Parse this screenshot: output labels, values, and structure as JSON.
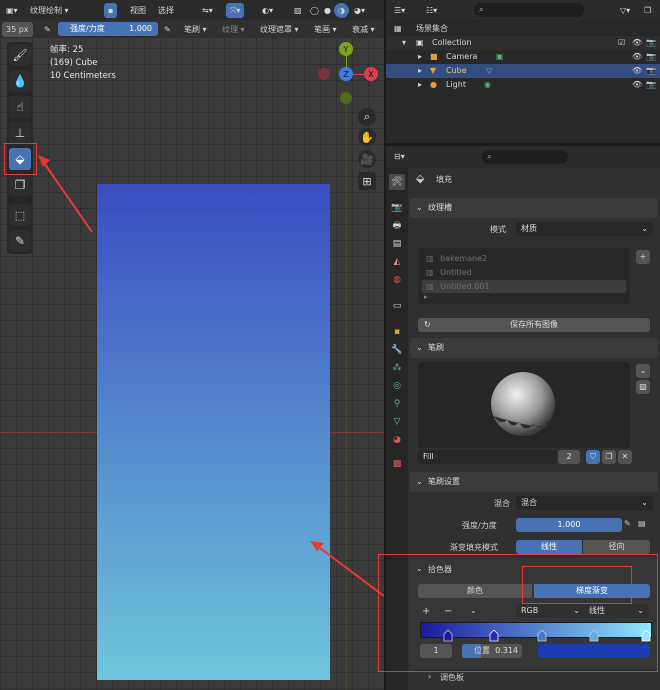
{
  "viewport": {
    "size_value": "35 px",
    "mode_label": "纹理绘制",
    "menu_view": "视图",
    "menu_select": "选择",
    "strength_label": "强度/力度",
    "strength_value": "1.000",
    "brush_label": "笔刷",
    "texture_label": "纹理",
    "texture_mask_label": "纹理遮罩",
    "stroke_label": "笔画",
    "falloff_label": "衰减",
    "info_frame": "帧率: 25",
    "info_object": "(169) Cube",
    "info_scale": "10 Centimeters",
    "gizmo": {
      "y": "Y",
      "z": "Z",
      "x": "X"
    },
    "gradient": {
      "top": "#3a4cc0",
      "bottom": "#6ec6dc"
    }
  },
  "outliner": {
    "search_placeholder": "",
    "scene_collection": "场景集合",
    "collection": "Collection",
    "camera": "Camera",
    "cube": "Cube",
    "light": "Light"
  },
  "properties": {
    "header_title": "填充",
    "texture_slots": {
      "title": "纹理槽",
      "mode_label": "模式",
      "mode_value": "材质",
      "items": [
        "bakemane2",
        "Untitled",
        "Untitled.001"
      ],
      "save_all": "保存所有图像"
    },
    "brush": {
      "title": "笔刷",
      "name": "Fill",
      "users": "2"
    },
    "brush_settings": {
      "title": "笔刷设置",
      "blend_label": "混合",
      "blend_value": "混合",
      "strength_label": "强度/力度",
      "strength_value": "1.000",
      "gradient_fill_label": "渐变填充模式",
      "linear": "线性",
      "radial": "径向"
    },
    "color_picker": {
      "title": "拾色器",
      "tab_color": "颜色",
      "tab_gradient": "梯度渐变",
      "plus": "+",
      "minus": "−",
      "color_mode": "RGB",
      "interp": "线性",
      "stop_index": "1",
      "position_label": "位置",
      "position_value": "0.314",
      "ramp_left": "#1a1a9e",
      "ramp_right": "#8fe8ff",
      "stop_color": "#1a3db0"
    },
    "palette_title": "调色板"
  }
}
